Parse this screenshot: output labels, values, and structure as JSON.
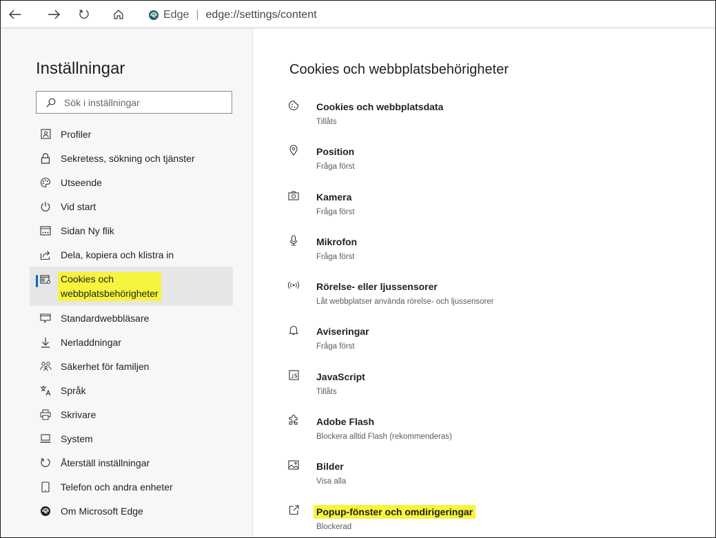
{
  "browser": {
    "brand": "Edge",
    "url": "edge://settings/content"
  },
  "sidebar": {
    "title": "Inställningar",
    "search_placeholder": "Sök i inställningar",
    "items": [
      {
        "label": "Profiler",
        "icon": "profile-icon"
      },
      {
        "label": "Sekretess, sökning och tjänster",
        "icon": "lock-icon"
      },
      {
        "label": "Utseende",
        "icon": "palette-icon"
      },
      {
        "label": "Vid start",
        "icon": "power-icon"
      },
      {
        "label": "Sidan Ny flik",
        "icon": "new-tab-icon"
      },
      {
        "label": "Dela, kopiera och klistra in",
        "icon": "share-icon"
      },
      {
        "label": "Cookies och webbplatsbehörigheter",
        "label_line1": "Cookies och",
        "label_line2": "webbplatsbehörigheter",
        "icon": "site-permissions-icon",
        "active": true
      },
      {
        "label": "Standardwebbläsare",
        "icon": "browser-icon"
      },
      {
        "label": "Nerladdningar",
        "icon": "download-icon"
      },
      {
        "label": "Säkerhet för familjen",
        "icon": "family-icon"
      },
      {
        "label": "Språk",
        "icon": "language-icon"
      },
      {
        "label": "Skrivare",
        "icon": "printer-icon"
      },
      {
        "label": "System",
        "icon": "system-icon"
      },
      {
        "label": "Återställ inställningar",
        "icon": "reset-icon"
      },
      {
        "label": "Telefon och andra enheter",
        "icon": "phone-icon"
      },
      {
        "label": "Om Microsoft Edge",
        "icon": "edge-logo-icon"
      }
    ]
  },
  "content": {
    "title": "Cookies och webbplatsbehörigheter",
    "permissions": [
      {
        "title": "Cookies och webbplatsdata",
        "status": "Tillåts",
        "icon": "cookie-icon"
      },
      {
        "title": "Position",
        "status": "Fråga först",
        "icon": "location-icon"
      },
      {
        "title": "Kamera",
        "status": "Fråga först",
        "icon": "camera-icon"
      },
      {
        "title": "Mikrofon",
        "status": "Fråga först",
        "icon": "microphone-icon"
      },
      {
        "title": "Rörelse- eller ljussensorer",
        "status": "Låt webbplatser använda rörelse- och ljussensorer",
        "icon": "sensor-icon"
      },
      {
        "title": "Aviseringar",
        "status": "Fråga först",
        "icon": "bell-icon"
      },
      {
        "title": "JavaScript",
        "status": "Tillåts",
        "icon": "javascript-icon"
      },
      {
        "title": "Adobe Flash",
        "status": "Blockera alltid Flash (rekommenderas)",
        "icon": "puzzle-icon"
      },
      {
        "title": "Bilder",
        "status": "Visa alla",
        "icon": "image-icon"
      },
      {
        "title": "Popup-fönster och omdirigeringar",
        "status": "Blockerad",
        "icon": "popup-icon",
        "highlighted": true
      }
    ]
  },
  "colors": {
    "highlight": "#f6f43c",
    "active_bar": "#0067c0"
  }
}
